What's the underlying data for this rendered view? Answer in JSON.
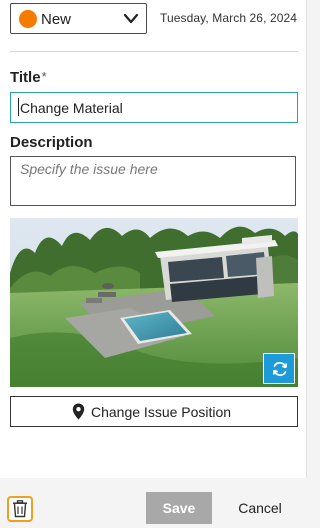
{
  "header": {
    "status": {
      "label": "New",
      "color": "#f57c00"
    },
    "date": "Tuesday, March 26, 2024"
  },
  "form": {
    "title_label": "Title",
    "required_mark": "*",
    "title_value": "Change Material",
    "description_label": "Description",
    "description_placeholder": "Specify the issue here",
    "description_value": ""
  },
  "viewer": {
    "refresh_icon": "refresh-icon"
  },
  "position_button": {
    "icon": "map-pin-icon",
    "label": "Change Issue Position"
  },
  "footer": {
    "delete_icon": "trash-icon",
    "save_label": "Save",
    "cancel_label": "Cancel"
  },
  "colors": {
    "accent": "#2aa0a8",
    "refresh_button": "#1d9bd8",
    "highlight": "#f0a020",
    "save_disabled": "#a8a8a8"
  }
}
